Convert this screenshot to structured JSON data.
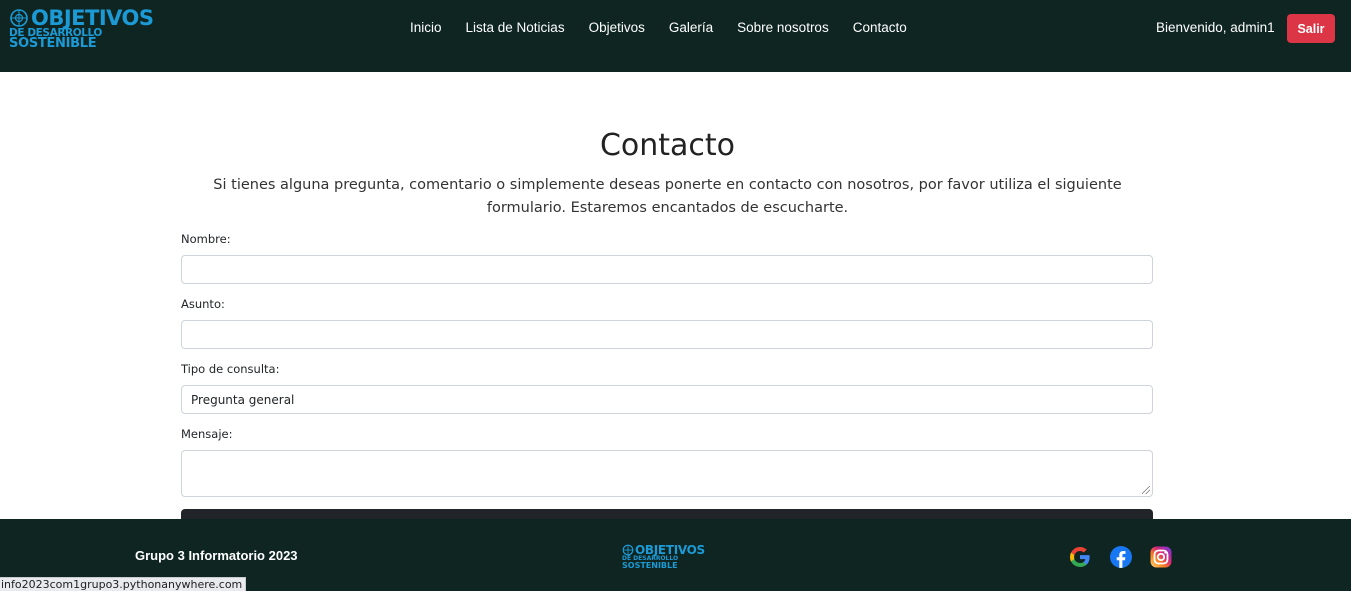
{
  "header": {
    "logo": {
      "line1": "OBJETIVOS",
      "line2": "DE DESARROLLO",
      "line3": "SOSTENIBLE"
    },
    "nav": [
      "Inicio",
      "Lista de Noticias",
      "Objetivos",
      "Galería",
      "Sobre nosotros",
      "Contacto"
    ],
    "welcome": "Bienvenido, admin1",
    "logout_label": "Salir"
  },
  "main": {
    "title": "Contacto",
    "intro": "Si tienes alguna pregunta, comentario o simplemente deseas ponerte en contacto con nosotros, por favor utiliza el siguiente formulario. Estaremos encantados de escucharte.",
    "form": {
      "name_label": "Nombre:",
      "name_value": "",
      "subject_label": "Asunto:",
      "subject_value": "",
      "type_label": "Tipo de consulta:",
      "type_selected": "Pregunta general",
      "message_label": "Mensaje:",
      "message_value": ""
    }
  },
  "footer": {
    "text": "Grupo 3 Informatorio 2023",
    "logo": {
      "line1": "OBJETIVOS",
      "line2": "DE DESARROLLO",
      "line3": "SOSTENIBLE"
    },
    "social_icons": [
      "google-icon",
      "facebook-icon",
      "instagram-icon"
    ]
  },
  "status_bar": {
    "url": "info2023com1grupo3.pythonanywhere.com"
  },
  "colors": {
    "navbar_bg": "#0e2521",
    "logo_blue": "#1c9ad6",
    "logout_red": "#dc3545",
    "submit_dark": "#212529"
  }
}
